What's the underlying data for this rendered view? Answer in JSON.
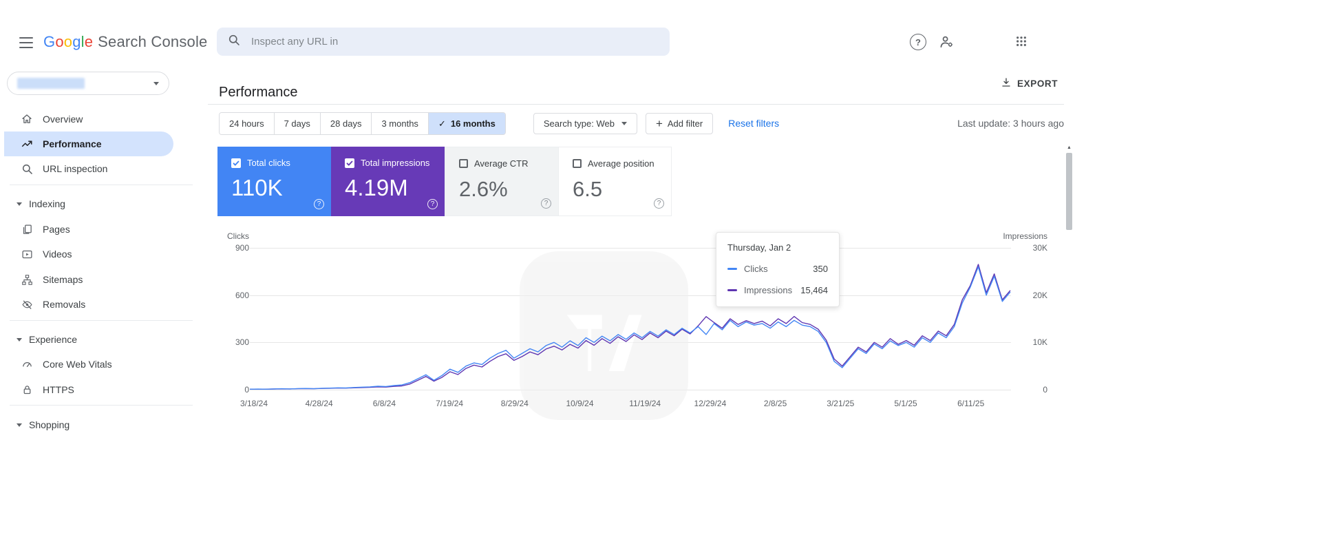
{
  "topbar": {
    "logo_letters": [
      "G",
      "o",
      "o",
      "g",
      "l",
      "e"
    ],
    "logo_suffix": "Search Console",
    "search_placeholder": "Inspect any URL in"
  },
  "icons": {
    "check": "✓",
    "plus": "+",
    "help": "?",
    "scroll_up": "▲"
  },
  "sidebar": {
    "items": [
      {
        "label": "Overview",
        "selected": false
      },
      {
        "label": "Performance",
        "selected": true
      },
      {
        "label": "URL inspection",
        "selected": false
      }
    ],
    "sections": [
      {
        "label": "Indexing",
        "items": [
          {
            "label": "Pages"
          },
          {
            "label": "Videos"
          },
          {
            "label": "Sitemaps"
          },
          {
            "label": "Removals"
          }
        ]
      },
      {
        "label": "Experience",
        "items": [
          {
            "label": "Core Web Vitals"
          },
          {
            "label": "HTTPS"
          }
        ]
      },
      {
        "label": "Shopping",
        "items": []
      }
    ]
  },
  "header": {
    "title": "Performance",
    "export_label": "EXPORT"
  },
  "filters": {
    "date_ranges": [
      "24 hours",
      "7 days",
      "28 days",
      "3 months",
      "16 months"
    ],
    "selected_range": "16 months",
    "search_type_label": "Search type: Web",
    "add_filter_label": "Add filter",
    "reset_filters_label": "Reset filters",
    "last_update": "Last update: 3 hours ago"
  },
  "metrics": [
    {
      "label": "Total clicks",
      "value": "110K",
      "checked": true,
      "color": "#4285f4"
    },
    {
      "label": "Total impressions",
      "value": "4.19M",
      "checked": true,
      "color": "#673ab7"
    },
    {
      "label": "Average CTR",
      "value": "2.6%",
      "checked": false
    },
    {
      "label": "Average position",
      "value": "6.5",
      "checked": false
    }
  ],
  "tooltip": {
    "date": "Thursday, Jan 2",
    "rows": [
      {
        "label": "Clicks",
        "value": "350",
        "color": "#4285f4"
      },
      {
        "label": "Impressions",
        "value": "15,464",
        "color": "#5e35b1"
      }
    ]
  },
  "chart_data": {
    "type": "line",
    "title": "Clicks and Impressions over 16 months",
    "grid": true,
    "legend": "none",
    "left_axis": {
      "label": "Clicks",
      "max": 900,
      "ticks_top_to_bottom": [
        "900",
        "600",
        "300",
        "0"
      ]
    },
    "right_axis": {
      "label": "Impressions",
      "max": 30000,
      "ticks_top_to_bottom": [
        "30K",
        "20K",
        "10K",
        "0"
      ]
    },
    "x_labels": [
      "3/18/24",
      "4/28/24",
      "6/8/24",
      "7/19/24",
      "8/29/24",
      "10/9/24",
      "11/19/24",
      "12/29/24",
      "2/8/25",
      "3/21/25",
      "5/1/25",
      "6/11/25"
    ],
    "series": [
      {
        "name": "Clicks",
        "axis": "left",
        "color": "#4285f4",
        "values": [
          3,
          4,
          3,
          5,
          6,
          5,
          7,
          8,
          6,
          9,
          10,
          12,
          11,
          14,
          16,
          18,
          22,
          20,
          26,
          30,
          45,
          70,
          95,
          60,
          90,
          130,
          110,
          150,
          170,
          160,
          200,
          230,
          250,
          200,
          230,
          260,
          240,
          280,
          300,
          270,
          310,
          280,
          330,
          300,
          340,
          310,
          350,
          320,
          360,
          330,
          370,
          340,
          380,
          350,
          390,
          360,
          400,
          350,
          420,
          380,
          440,
          400,
          430,
          410,
          420,
          390,
          430,
          400,
          440,
          410,
          400,
          370,
          300,
          180,
          140,
          200,
          260,
          230,
          290,
          260,
          310,
          280,
          300,
          270,
          330,
          300,
          360,
          330,
          400,
          550,
          650,
          780,
          600,
          720,
          560,
          620
        ]
      },
      {
        "name": "Impressions",
        "axis": "right",
        "color": "#5e35b1",
        "values": [
          100,
          120,
          110,
          150,
          180,
          160,
          200,
          230,
          210,
          260,
          300,
          350,
          330,
          400,
          450,
          500,
          600,
          560,
          700,
          800,
          1200,
          2000,
          2800,
          1800,
          2600,
          3800,
          3200,
          4500,
          5200,
          4800,
          6000,
          7000,
          7600,
          6200,
          7000,
          8000,
          7400,
          8600,
          9200,
          8400,
          9600,
          8800,
          10400,
          9400,
          10800,
          9800,
          11200,
          10200,
          11600,
          10600,
          12000,
          11000,
          12400,
          11400,
          12800,
          11800,
          13500,
          15464,
          14200,
          13000,
          15000,
          13800,
          14600,
          14000,
          14500,
          13500,
          15000,
          14000,
          15500,
          14200,
          13800,
          12800,
          10500,
          6500,
          5000,
          7000,
          9000,
          8000,
          10000,
          9000,
          10800,
          9600,
          10400,
          9400,
          11400,
          10400,
          12400,
          11400,
          13800,
          19000,
          22000,
          26500,
          20500,
          24500,
          19000,
          21000
        ]
      }
    ]
  },
  "colors": {
    "accent_blue": "#1a73e8",
    "clicks_blue": "#4285f4",
    "impressions_purple": "#5e35b1",
    "selected_chip_bg": "#cfe0fb",
    "selected_nav_bg": "#d3e3fd"
  }
}
